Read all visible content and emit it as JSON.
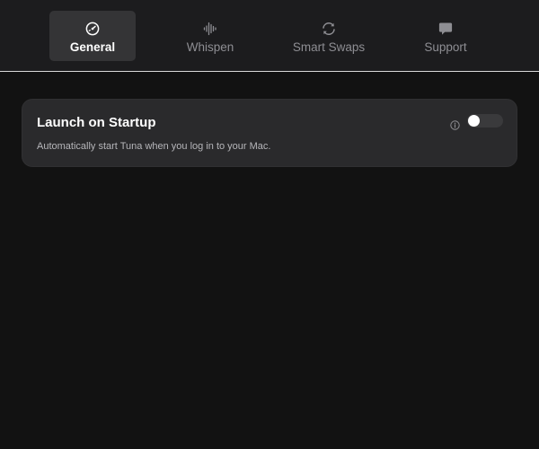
{
  "tabs": [
    {
      "id": "general",
      "label": "General",
      "icon": "speedometer-gear-icon",
      "active": true
    },
    {
      "id": "whispen",
      "label": "Whispen",
      "icon": "waveform-icon",
      "active": false
    },
    {
      "id": "smart_swaps",
      "label": "Smart Swaps",
      "icon": "refresh-arrows-icon",
      "active": false
    },
    {
      "id": "support",
      "label": "Support",
      "icon": "chat-bubble-icon",
      "active": false
    }
  ],
  "settings": {
    "launch_on_startup": {
      "title": "Launch on Startup",
      "description": "Automatically start Tuna when you log in to your Mac.",
      "enabled": false,
      "info_icon": "info-circle-icon"
    }
  },
  "colors": {
    "background": "#121212",
    "toolbar": "#1c1c1e",
    "active_tab": "#343436",
    "card": "#2a2a2c",
    "toggle_off": "#3a3a3c"
  }
}
